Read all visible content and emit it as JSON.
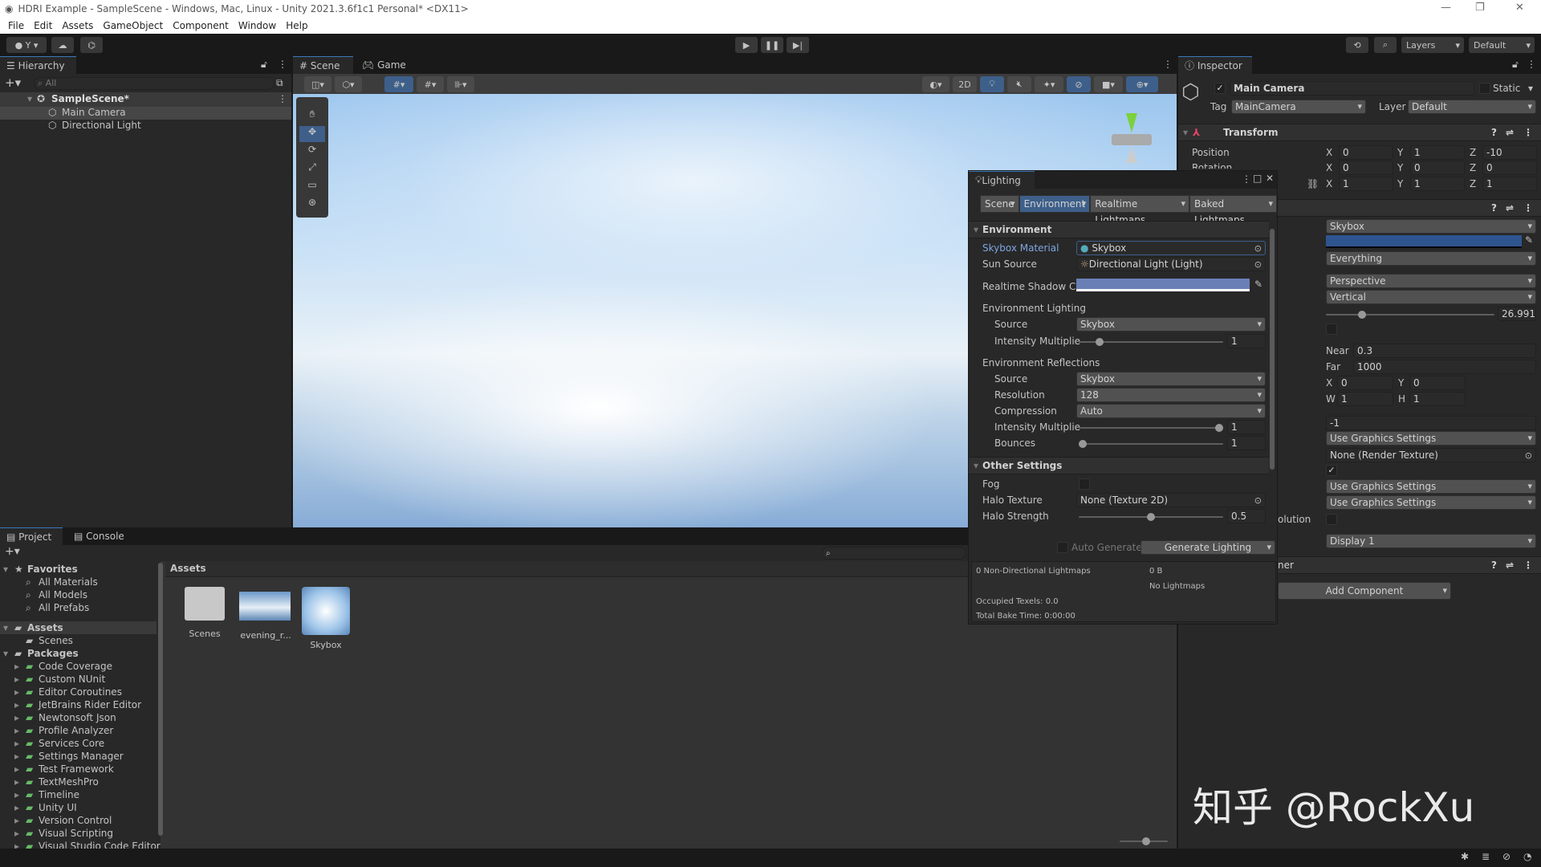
{
  "window": {
    "title": "HDRI Example - SampleScene - Windows, Mac, Linux - Unity 2021.3.6f1c1 Personal* <DX11>"
  },
  "menu": [
    "File",
    "Edit",
    "Assets",
    "GameObject",
    "Component",
    "Window",
    "Help"
  ],
  "toolbar": {
    "account": "Y",
    "layers": "Layers",
    "layout": "Default"
  },
  "hierarchy": {
    "tab": "Hierarchy",
    "search_placeholder": "All",
    "scene": "SampleScene*",
    "items": [
      "Main Camera",
      "Directional Light"
    ]
  },
  "scene": {
    "tabs": [
      "Scene",
      "Game"
    ],
    "mode_2d": "2D"
  },
  "inspector": {
    "tab": "Inspector",
    "object_name": "Main Camera",
    "static_label": "Static",
    "tag_label": "Tag",
    "tag": "MainCamera",
    "layer_label": "Layer",
    "layer": "Default",
    "transform": {
      "title": "Transform",
      "position_label": "Position",
      "rotation_label": "Rotation",
      "position": {
        "x": "0",
        "y": "1",
        "z": "-10"
      },
      "rotation": {
        "x": "0",
        "y": "0",
        "z": "0"
      },
      "scale": {
        "x": "1",
        "y": "1",
        "z": "1"
      }
    },
    "camera": {
      "clear_flags": "Skybox",
      "culling_mask": "Everything",
      "projection": "Perspective",
      "fov_axis": "Vertical",
      "fov": "26.9914",
      "fov_fraction": 0.2,
      "near_label": "Near",
      "near": "0.3",
      "far_label": "Far",
      "far": "1000",
      "rect": {
        "x": "0",
        "y": "0",
        "w": "1",
        "h": "1"
      },
      "depth": "-1",
      "rendering_path": "Use Graphics Settings",
      "target_texture": "None (Render Texture)",
      "hdr": "Use Graphics Settings",
      "msaa": "Use Graphics Settings",
      "label_partial": "olution",
      "target_display": "Display 1",
      "background_color": "#2f5590"
    },
    "next_component_partial": "ner",
    "add_component": "Add Component"
  },
  "lighting": {
    "title": "Lighting",
    "tabs": [
      "Scene",
      "Environment",
      "Realtime Lightmaps",
      "Baked Lightmaps"
    ],
    "active_tab": "Environment",
    "environment": {
      "header": "Environment",
      "skybox_label": "Skybox Material",
      "skybox": "Skybox",
      "sun_label": "Sun Source",
      "sun": "Directional Light (Light)",
      "shadow_label": "Realtime Shadow Cc",
      "shadow_color": "#6a7fb5"
    },
    "env_lighting": {
      "header": "Environment Lighting",
      "source_label": "Source",
      "source": "Skybox",
      "intensity_label": "Intensity Multiplie",
      "intensity": "1",
      "intensity_fraction": 0.125
    },
    "env_reflections": {
      "header": "Environment Reflections",
      "source_label": "Source",
      "source": "Skybox",
      "resolution_label": "Resolution",
      "resolution": "128",
      "compression_label": "Compression",
      "compression": "Auto",
      "intensity_label": "Intensity Multiplie",
      "intensity": "1",
      "intensity_fraction": 1.0,
      "bounces_label": "Bounces",
      "bounces": "1",
      "bounces_fraction": 0.0
    },
    "other": {
      "header": "Other Settings",
      "fog_label": "Fog",
      "halo_tex_label": "Halo Texture",
      "halo_tex": "None (Texture 2D)",
      "halo_strength_label": "Halo Strength",
      "halo_strength": "0.5",
      "halo_fraction": 0.5
    },
    "auto_generate": "Auto Generate",
    "generate": "Generate Lighting",
    "stats": {
      "lightmaps": "0 Non-Directional Lightmaps",
      "size": "0 B",
      "no_lightmaps": "No Lightmaps",
      "texels": "Occupied Texels: 0.0",
      "bake_time": "Total Bake Time: 0:00:00"
    }
  },
  "project": {
    "tabs": [
      "Project",
      "Console"
    ],
    "favorites": {
      "label": "Favorites",
      "items": [
        "All Materials",
        "All Models",
        "All Prefabs"
      ]
    },
    "assets": {
      "label": "Assets",
      "items": [
        "Scenes"
      ]
    },
    "packages": {
      "label": "Packages",
      "items": [
        "Code Coverage",
        "Custom NUnit",
        "Editor Coroutines",
        "JetBrains Rider Editor",
        "Newtonsoft Json",
        "Profile Analyzer",
        "Services Core",
        "Settings Manager",
        "Test Framework",
        "TextMeshPro",
        "Timeline",
        "Unity UI",
        "Version Control",
        "Visual Scripting",
        "Visual Studio Code Editor"
      ]
    },
    "breadcrumb": "Assets",
    "grid": [
      "Scenes",
      "evening_r...",
      "Skybox"
    ]
  },
  "watermark": "知乎 @RockXu"
}
